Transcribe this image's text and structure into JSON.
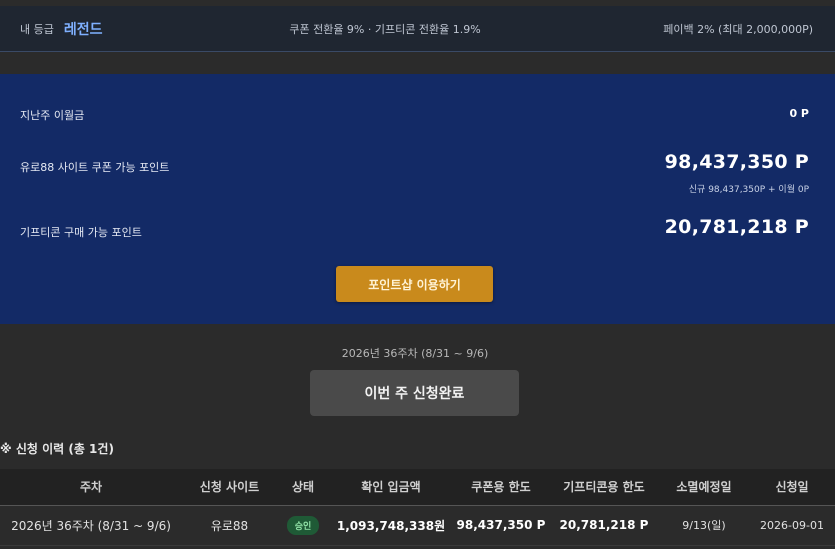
{
  "grade": {
    "label": "내 등급",
    "name": "레전드",
    "conversion": "쿠폰 전환율 9% · 기프티콘 전환율 1.9%",
    "payback": "페이백 2% (최대 2,000,000P)"
  },
  "points": {
    "carryover_label": "지난주 이월금",
    "carryover_value": "0 P",
    "coupon_label": "유로88 사이트 쿠폰 가능 포인트",
    "coupon_value": "98,437,350 P",
    "coupon_note": "신규 98,437,350P + 이월 0P",
    "gifticon_label": "기프티콘 구매 가능 포인트",
    "gifticon_value": "20,781,218 P",
    "shop_button": "포인트샵 이용하기"
  },
  "week": {
    "label": "2026년 36주차 (8/31 ~ 9/6)",
    "apply_button": "이번 주 신청완료"
  },
  "history": {
    "title": "※ 신청 이력 (총 1건)",
    "columns": [
      "주차",
      "신청 사이트",
      "상태",
      "확인 입금액",
      "쿠폰용 한도",
      "기프티콘용 한도",
      "소멸예정일",
      "신청일"
    ],
    "rows": [
      {
        "week": "2026년 36주차 (8/31 ~ 9/6)",
        "site": "유로88",
        "status": "승인",
        "deposit": "1,093,748,338원",
        "coupon_limit": "98,437,350 P",
        "gifticon_limit": "20,781,218 P",
        "expiry": "9/13(일)",
        "applied": "2026-09-01"
      }
    ]
  },
  "colors": {
    "panel": "#132a66",
    "accent_button": "#c98a1c",
    "grade_name": "#7fb0ff",
    "status_badge": "#1f5a36"
  }
}
